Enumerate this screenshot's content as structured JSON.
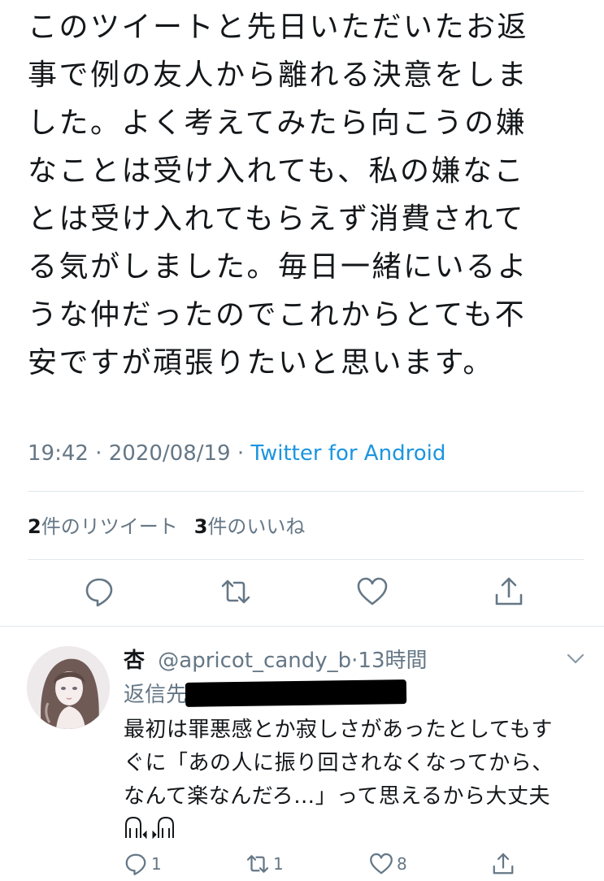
{
  "tweet": {
    "lines": [
      "このツイートと先日いただいたお返",
      "事で例の友人から離れる決意をしま",
      "した。よく考えてみたら向こうの嫌",
      "なことは受け入れても、私の嫌なこ",
      "とは受け入れてもらえず消費されて",
      "る気がしました。毎日一緒にいるよ",
      "うな仲だったのでこれからとても不",
      "安ですが頑張りたいと思います。"
    ],
    "time": "19:42",
    "sep": "·",
    "date": "2020/08/19",
    "source": "Twitter for Android"
  },
  "stats": {
    "retweets_count": "2",
    "retweets_label": "件のリツイート",
    "likes_count": "3",
    "likes_label": "件のいいね"
  },
  "actions": [
    "reply-icon",
    "retweet-icon",
    "like-icon",
    "share-icon"
  ],
  "reply": {
    "name": "杏",
    "handle": "@apricot_candy_b",
    "sep": "·",
    "time": "13時間",
    "replying_label": "返信先:",
    "lines": [
      "最初は罪悪感とか寂しさがあったとしてもす",
      "ぐに「あの人に振り回されなくなってから、",
      "なんて楽なんだろ…」って思えるから大丈夫"
    ],
    "reply_count": "1",
    "retweet_count": "1",
    "like_count": "8"
  },
  "colors": {
    "text": "#14171a",
    "secondary": "#657786",
    "link": "#1b95e0",
    "divider": "#e1e8ed"
  }
}
